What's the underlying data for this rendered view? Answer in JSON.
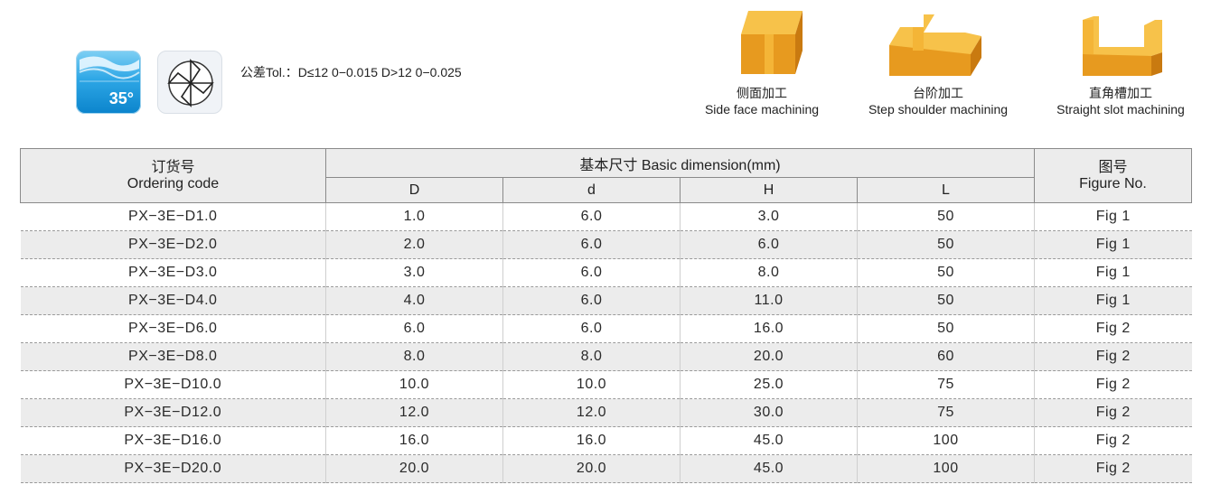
{
  "header": {
    "helix_angle": "35°",
    "tolerance_text": "公差Tol.：D≤12 0−0.015  D>12 0−0.025"
  },
  "machining": [
    {
      "zh": "侧面加工",
      "en": "Side face machining"
    },
    {
      "zh": "台阶加工",
      "en": "Step shoulder machining"
    },
    {
      "zh": "直角槽加工",
      "en": "Straight slot machining"
    }
  ],
  "table": {
    "ordering_zh": "订货号",
    "ordering_en": "Ordering code",
    "basic_dim": "基本尺寸  Basic dimension(mm)",
    "figure_zh": "图号",
    "figure_en": "Figure No.",
    "columns": [
      "D",
      "d",
      "H",
      "L"
    ],
    "rows": [
      {
        "code": "PX−3E−D1.0",
        "D": "1.0",
        "d": "6.0",
        "H": "3.0",
        "L": "50",
        "fig": "Fig 1"
      },
      {
        "code": "PX−3E−D2.0",
        "D": "2.0",
        "d": "6.0",
        "H": "6.0",
        "L": "50",
        "fig": "Fig 1"
      },
      {
        "code": "PX−3E−D3.0",
        "D": "3.0",
        "d": "6.0",
        "H": "8.0",
        "L": "50",
        "fig": "Fig 1"
      },
      {
        "code": "PX−3E−D4.0",
        "D": "4.0",
        "d": "6.0",
        "H": "11.0",
        "L": "50",
        "fig": "Fig 1"
      },
      {
        "code": "PX−3E−D6.0",
        "D": "6.0",
        "d": "6.0",
        "H": "16.0",
        "L": "50",
        "fig": "Fig 2"
      },
      {
        "code": "PX−3E−D8.0",
        "D": "8.0",
        "d": "8.0",
        "H": "20.0",
        "L": "60",
        "fig": "Fig 2"
      },
      {
        "code": "PX−3E−D10.0",
        "D": "10.0",
        "d": "10.0",
        "H": "25.0",
        "L": "75",
        "fig": "Fig 2"
      },
      {
        "code": "PX−3E−D12.0",
        "D": "12.0",
        "d": "12.0",
        "H": "30.0",
        "L": "75",
        "fig": "Fig 2"
      },
      {
        "code": "PX−3E−D16.0",
        "D": "16.0",
        "d": "16.0",
        "H": "45.0",
        "L": "100",
        "fig": "Fig 2"
      },
      {
        "code": "PX−3E−D20.0",
        "D": "20.0",
        "d": "20.0",
        "H": "45.0",
        "L": "100",
        "fig": "Fig 2"
      }
    ]
  }
}
